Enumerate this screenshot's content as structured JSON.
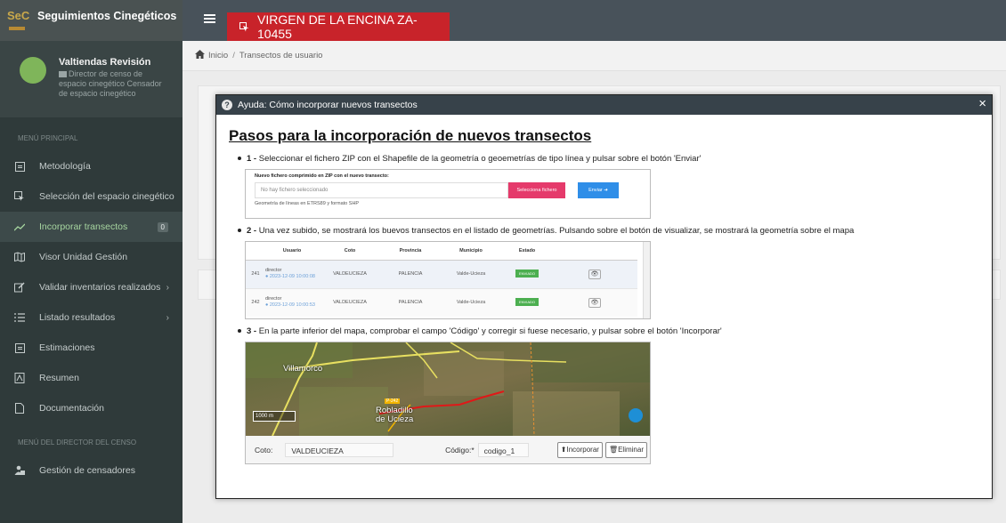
{
  "app": {
    "brand_logo_text": "SeC",
    "brand_title": "Seguimientos Cinegéticos"
  },
  "user": {
    "name": "Valtiendas Revisión",
    "role": "Director de censo de espacio cinegético Censador de espacio cinegético"
  },
  "sidebar": {
    "section_main": "MENÚ PRINCIPAL",
    "section_director": "MENÚ DEL DIRECTOR DEL CENSO",
    "items": [
      {
        "label": "Metodología"
      },
      {
        "label": "Selección del espacio cinegético"
      },
      {
        "label": "Incorporar transectos",
        "badge": "0"
      },
      {
        "label": "Visor Unidad Gestión"
      },
      {
        "label": "Validar inventarios realizados"
      },
      {
        "label": "Listado resultados"
      },
      {
        "label": "Estimaciones"
      },
      {
        "label": "Resumen"
      },
      {
        "label": "Documentación"
      },
      {
        "label": "Gestión de censadores"
      }
    ]
  },
  "header": {
    "title": "VIRGEN DE LA ENCINA ZA-10455"
  },
  "breadcrumb": {
    "home": "Inicio",
    "separator": "/",
    "current": "Transectos de usuario"
  },
  "modal": {
    "title": "Ayuda: Cómo incorporar nuevos transectos",
    "close": "×",
    "heading": "Pasos para la incorporación de nuevos transectos",
    "steps": [
      {
        "num": "1 -",
        "text": "Seleccionar el fichero ZIP con el Shapefile de la geometría o geoemetrías de tipo línea y pulsar sobre el botón 'Enviar'"
      },
      {
        "num": "2 -",
        "text": "Una vez subido, se mostrará los buevos transectos en el listado de geometrías. Pulsando sobre el botón de visualizar, se mostrará la geometría sobre el mapa"
      },
      {
        "num": "3 -",
        "text": "En la parte inferior del mapa, comprobar el campo 'Código' y corregir si fuese necesario, y pulsar sobre el botón 'Incorporar'"
      }
    ],
    "upload": {
      "label": "Nuevo fichero comprimido en ZIP con el nuevo transecto:",
      "placeholder": "No hay fichero seleccionado",
      "select_button": "Selecciona fichero",
      "send_button": "Enviar",
      "hint": "Geometría de líneas en ETRS89 y formato SHP"
    },
    "table": {
      "headers": [
        "Usuario",
        "Coto",
        "Provincia",
        "Municipio",
        "Estado"
      ],
      "rows": [
        {
          "id": "241",
          "user": "director",
          "date": "2023-12-09 10:00:08",
          "coto": "VALDEUCIEZA",
          "provincia": "PALENCIA",
          "municipio": "Valde-Ucieza",
          "estado": "ENVIADO"
        },
        {
          "id": "242",
          "user": "director",
          "date": "2023-12-09 10:00:53",
          "coto": "VALDEUCIEZA",
          "provincia": "PALENCIA",
          "municipio": "Valde-Ucieza",
          "estado": "ENVIADO"
        }
      ]
    },
    "map": {
      "place1": "Villamorco",
      "place2": "Robladillo\nde Ucieza",
      "road": "P-242",
      "scale": "1000 m",
      "coto_label": "Coto:",
      "coto_value": "VALDEUCIEZA",
      "codigo_label": "Código:*",
      "codigo_value": "codigo_1",
      "incorporar": "Incorporar",
      "eliminar": "Eliminar"
    }
  },
  "colors": {
    "header_red": "#c8232a",
    "sidebar_bg": "#2f3a3a",
    "active_green": "#a7d6a0",
    "select_pink": "#e53a6b",
    "send_blue": "#2f8ee8"
  }
}
